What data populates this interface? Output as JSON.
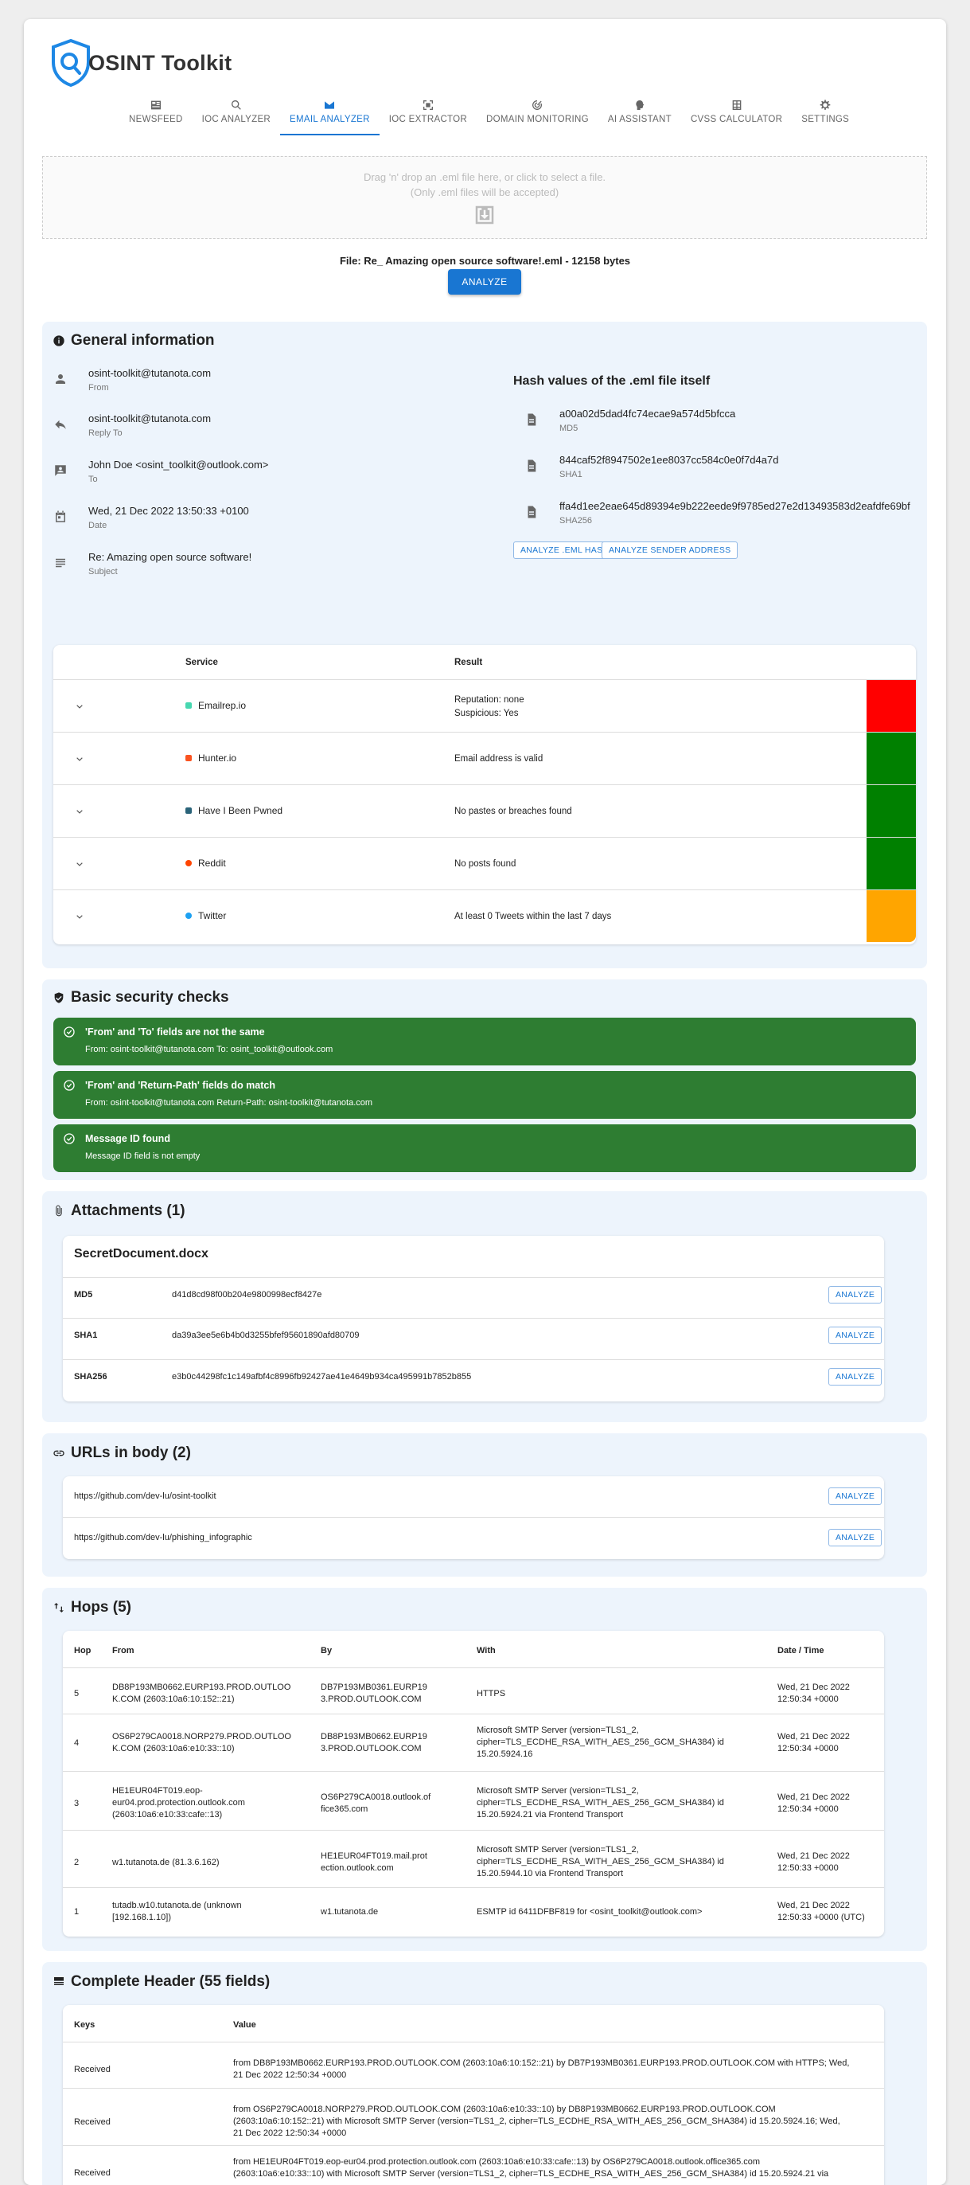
{
  "app": {
    "title": "OSINT Toolkit"
  },
  "nav": [
    {
      "label": "NEWSFEED",
      "icon": "newspaper-icon"
    },
    {
      "label": "IOC ANALYZER",
      "icon": "search-icon"
    },
    {
      "label": "EMAIL ANALYZER",
      "icon": "email-icon"
    },
    {
      "label": "IOC EXTRACTOR",
      "icon": "crop-icon"
    },
    {
      "label": "DOMAIN MONITORING",
      "icon": "radar-icon"
    },
    {
      "label": "AI ASSISTANT",
      "icon": "brain-icon"
    },
    {
      "label": "CVSS CALCULATOR",
      "icon": "calculator-icon"
    },
    {
      "label": "SETTINGS",
      "icon": "gear-icon"
    }
  ],
  "dropzone": {
    "line1": "Drag 'n' drop an .eml file here, or click to select a file.",
    "line2": "(Only .eml files will be accepted)"
  },
  "file": {
    "info": "File: Re_ Amazing open source software!.eml - 12158 bytes",
    "analyze_label": "ANALYZE"
  },
  "general": {
    "title": "General information",
    "rows": [
      {
        "value": "osint-toolkit@tutanota.com",
        "label": "From"
      },
      {
        "value": "osint-toolkit@tutanota.com",
        "label": "Reply To"
      },
      {
        "value": "John Doe <osint_toolkit@outlook.com>",
        "label": "To"
      },
      {
        "value": "Wed, 21 Dec 2022 13:50:33 +0100",
        "label": "Date"
      },
      {
        "value": "Re: Amazing open source software!",
        "label": "Subject"
      }
    ],
    "hash_title": "Hash values of the .eml file itself",
    "hashes": [
      {
        "value": "a00a02d5dad4fc74ecae9a574d5bfcca",
        "label": "MD5"
      },
      {
        "value": "844caf52f8947502e1ee8037cc584c0e0f7d4a7d",
        "label": "SHA1"
      },
      {
        "value": "ffa4d1ee2eae645d89394e9b222eede9f9785ed27e2d13493583d2eafdfe69bf",
        "label": "SHA256"
      }
    ],
    "btn_hash": "ANALYZE .EML HASH",
    "btn_sender": "ANALYZE SENDER ADDRESS"
  },
  "services": {
    "header_service": "Service",
    "header_result": "Result",
    "rows": [
      {
        "name": "Emailrep.io",
        "result1": "Reputation: none",
        "result2": "Suspicious: Yes",
        "color": "#ff0000",
        "dot": "#47d7b0"
      },
      {
        "name": "Hunter.io",
        "result1": "Email address is valid",
        "result2": "",
        "color": "#008000",
        "dot": "#fa5320"
      },
      {
        "name": "Have I Been Pwned",
        "result1": "No pastes or breaches found",
        "result2": "",
        "color": "#008000",
        "dot": "#2a6379"
      },
      {
        "name": "Reddit",
        "result1": "No posts found",
        "result2": "",
        "color": "#008000",
        "dot": "#ff4500"
      },
      {
        "name": "Twitter",
        "result1": "At least 0 Tweets within the last 7 days",
        "result2": "",
        "color": "#ffa500",
        "dot": "#1da1f2"
      }
    ]
  },
  "security": {
    "title": "Basic security checks",
    "checks": [
      {
        "title": "'From' and 'To' fields are not the same",
        "sub": "From: osint-toolkit@tutanota.com To: osint_toolkit@outlook.com"
      },
      {
        "title": "'From' and 'Return-Path' fields do match",
        "sub": "From: osint-toolkit@tutanota.com Return-Path: osint-toolkit@tutanota.com"
      },
      {
        "title": "Message ID found",
        "sub": "Message ID field is not empty"
      }
    ]
  },
  "attachments": {
    "title": "Attachments (1)",
    "file_name": "SecretDocument.docx",
    "rows": [
      {
        "label": "MD5",
        "value": "d41d8cd98f00b204e9800998ecf8427e"
      },
      {
        "label": "SHA1",
        "value": "da39a3ee5e6b4b0d3255bfef95601890afd80709"
      },
      {
        "label": "SHA256",
        "value": "e3b0c44298fc1c149afbf4c8996fb92427ae41e4649b934ca495991b7852b855"
      }
    ],
    "analyze_label": "ANALYZE"
  },
  "urls": {
    "title": "URLs in body (2)",
    "items": [
      "https://github.com/dev-lu/osint-toolkit",
      "https://github.com/dev-lu/phishing_infographic"
    ],
    "analyze_label": "ANALYZE"
  },
  "hops": {
    "title": "Hops (5)",
    "headers": [
      "Hop",
      "From",
      "By",
      "With",
      "Date / Time"
    ],
    "rows": [
      {
        "hop": "5",
        "from": "DB8P193MB0662.EURP193.PROD.OUTLOO\nK.COM (2603:10a6:10:152::21)",
        "by": "DB7P193MB0361.EURP19\n3.PROD.OUTLOOK.COM",
        "with": "HTTPS",
        "date": "Wed, 21 Dec 2022\n12:50:34 +0000"
      },
      {
        "hop": "4",
        "from": "OS6P279CA0018.NORP279.PROD.OUTLOO\nK.COM (2603:10a6:e10:33::10)",
        "by": "DB8P193MB0662.EURP19\n3.PROD.OUTLOOK.COM",
        "with": "Microsoft SMTP Server (version=TLS1_2,\ncipher=TLS_ECDHE_RSA_WITH_AES_256_GCM_SHA384) id\n15.20.5924.16",
        "date": "Wed, 21 Dec 2022\n12:50:34 +0000"
      },
      {
        "hop": "3",
        "from": "HE1EUR04FT019.eop-\neur04.prod.protection.outlook.com\n(2603:10a6:e10:33:cafe::13)",
        "by": "OS6P279CA0018.outlook.of\nfice365.com",
        "with": "Microsoft SMTP Server (version=TLS1_2,\ncipher=TLS_ECDHE_RSA_WITH_AES_256_GCM_SHA384) id\n15.20.5924.21 via Frontend Transport",
        "date": "Wed, 21 Dec 2022\n12:50:34 +0000"
      },
      {
        "hop": "2",
        "from": "w1.tutanota.de (81.3.6.162)",
        "by": "HE1EUR04FT019.mail.prot\nection.outlook.com",
        "with": "Microsoft SMTP Server (version=TLS1_2,\ncipher=TLS_ECDHE_RSA_WITH_AES_256_GCM_SHA384) id\n15.20.5944.10 via Frontend Transport",
        "date": "Wed, 21 Dec 2022\n12:50:33 +0000"
      },
      {
        "hop": "1",
        "from": "tutadb.w10.tutanota.de (unknown\n[192.168.1.10])",
        "by": "w1.tutanota.de",
        "with": "ESMTP id 6411DFBF819 for <osint_toolkit@outlook.com>",
        "date": "Wed, 21 Dec 2022\n12:50:33 +0000 (UTC)"
      }
    ]
  },
  "header": {
    "title": "Complete Header (55 fields)",
    "col_keys": "Keys",
    "col_value": "Value",
    "rows": [
      {
        "key": "Received",
        "value": "from DB8P193MB0662.EURP193.PROD.OUTLOOK.COM (2603:10a6:10:152::21) by DB7P193MB0361.EURP193.PROD.OUTLOOK.COM with HTTPS; Wed,\n21 Dec 2022 12:50:34 +0000"
      },
      {
        "key": "Received",
        "value": "from OS6P279CA0018.NORP279.PROD.OUTLOOK.COM (2603:10a6:e10:33::10) by DB8P193MB0662.EURP193.PROD.OUTLOOK.COM\n(2603:10a6:10:152::21) with Microsoft SMTP Server (version=TLS1_2, cipher=TLS_ECDHE_RSA_WITH_AES_256_GCM_SHA384) id 15.20.5924.16; Wed,\n21 Dec 2022 12:50:34 +0000"
      },
      {
        "key": "Received",
        "value": "from HE1EUR04FT019.eop-eur04.prod.protection.outlook.com (2603:10a6:e10:33:cafe::13) by OS6P279CA0018.outlook.office365.com\n(2603:10a6:e10:33::10) with Microsoft SMTP Server (version=TLS1_2, cipher=TLS_ECDHE_RSA_WITH_AES_256_GCM_SHA384) id 15.20.5924.21 via"
      }
    ]
  }
}
